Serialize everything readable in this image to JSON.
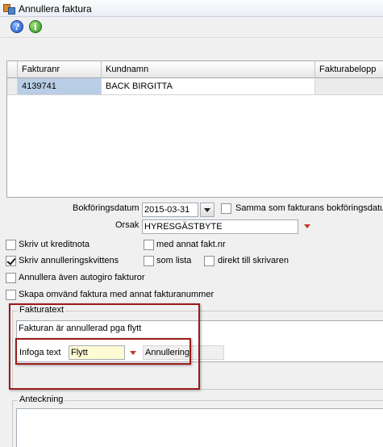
{
  "window": {
    "title": "Annullera faktura"
  },
  "toolbar": {
    "help_icon": "help-icon",
    "info_icon": "info-icon"
  },
  "grid": {
    "columns": [
      "Fakturanr",
      "Kundnamn",
      "Fakturabelopp"
    ],
    "rows": [
      {
        "fakturanr": "4139741",
        "kundnamn": "BACK BIRGITTA",
        "fakturabelopp": ""
      }
    ]
  },
  "form": {
    "bokforingsdatum_label": "Bokföringsdatum",
    "bokforingsdatum_value": "2015-03-31",
    "samma_label": "Samma som fakturans bokföringsdatum",
    "orsak_label": "Orsak",
    "orsak_value": "HYRESGÄSTBYTE",
    "skriv_kreditnota_label": "Skriv ut kreditnota",
    "med_annat_label": "med annat fakt.nr",
    "skriv_kvitto_label": "Skriv annulleringskvittens",
    "som_lista_label": "som lista",
    "direkt_label": "direkt till skrivaren",
    "annullera_autogiro_label": "Annullera även autogiro fakturor",
    "skapa_omvand_label": "Skapa omvänd faktura med annat fakturanummer"
  },
  "checkboxes": {
    "samma": false,
    "kreditnota": false,
    "med_annat": false,
    "kvitto": true,
    "som_lista": false,
    "direkt": false,
    "autogiro": false,
    "omvand": false
  },
  "fakturatext": {
    "title": "Fakturatext",
    "text": "Fakturan är annullerad pga flytt",
    "infoga_label": "Infoga text",
    "infoga_value": "Flytt",
    "type_value": "Annullering"
  },
  "anteckning": {
    "title": "Anteckning",
    "text": ""
  },
  "colors": {
    "highlight_border": "#9b1b1b",
    "selection": "#b9cde6"
  }
}
